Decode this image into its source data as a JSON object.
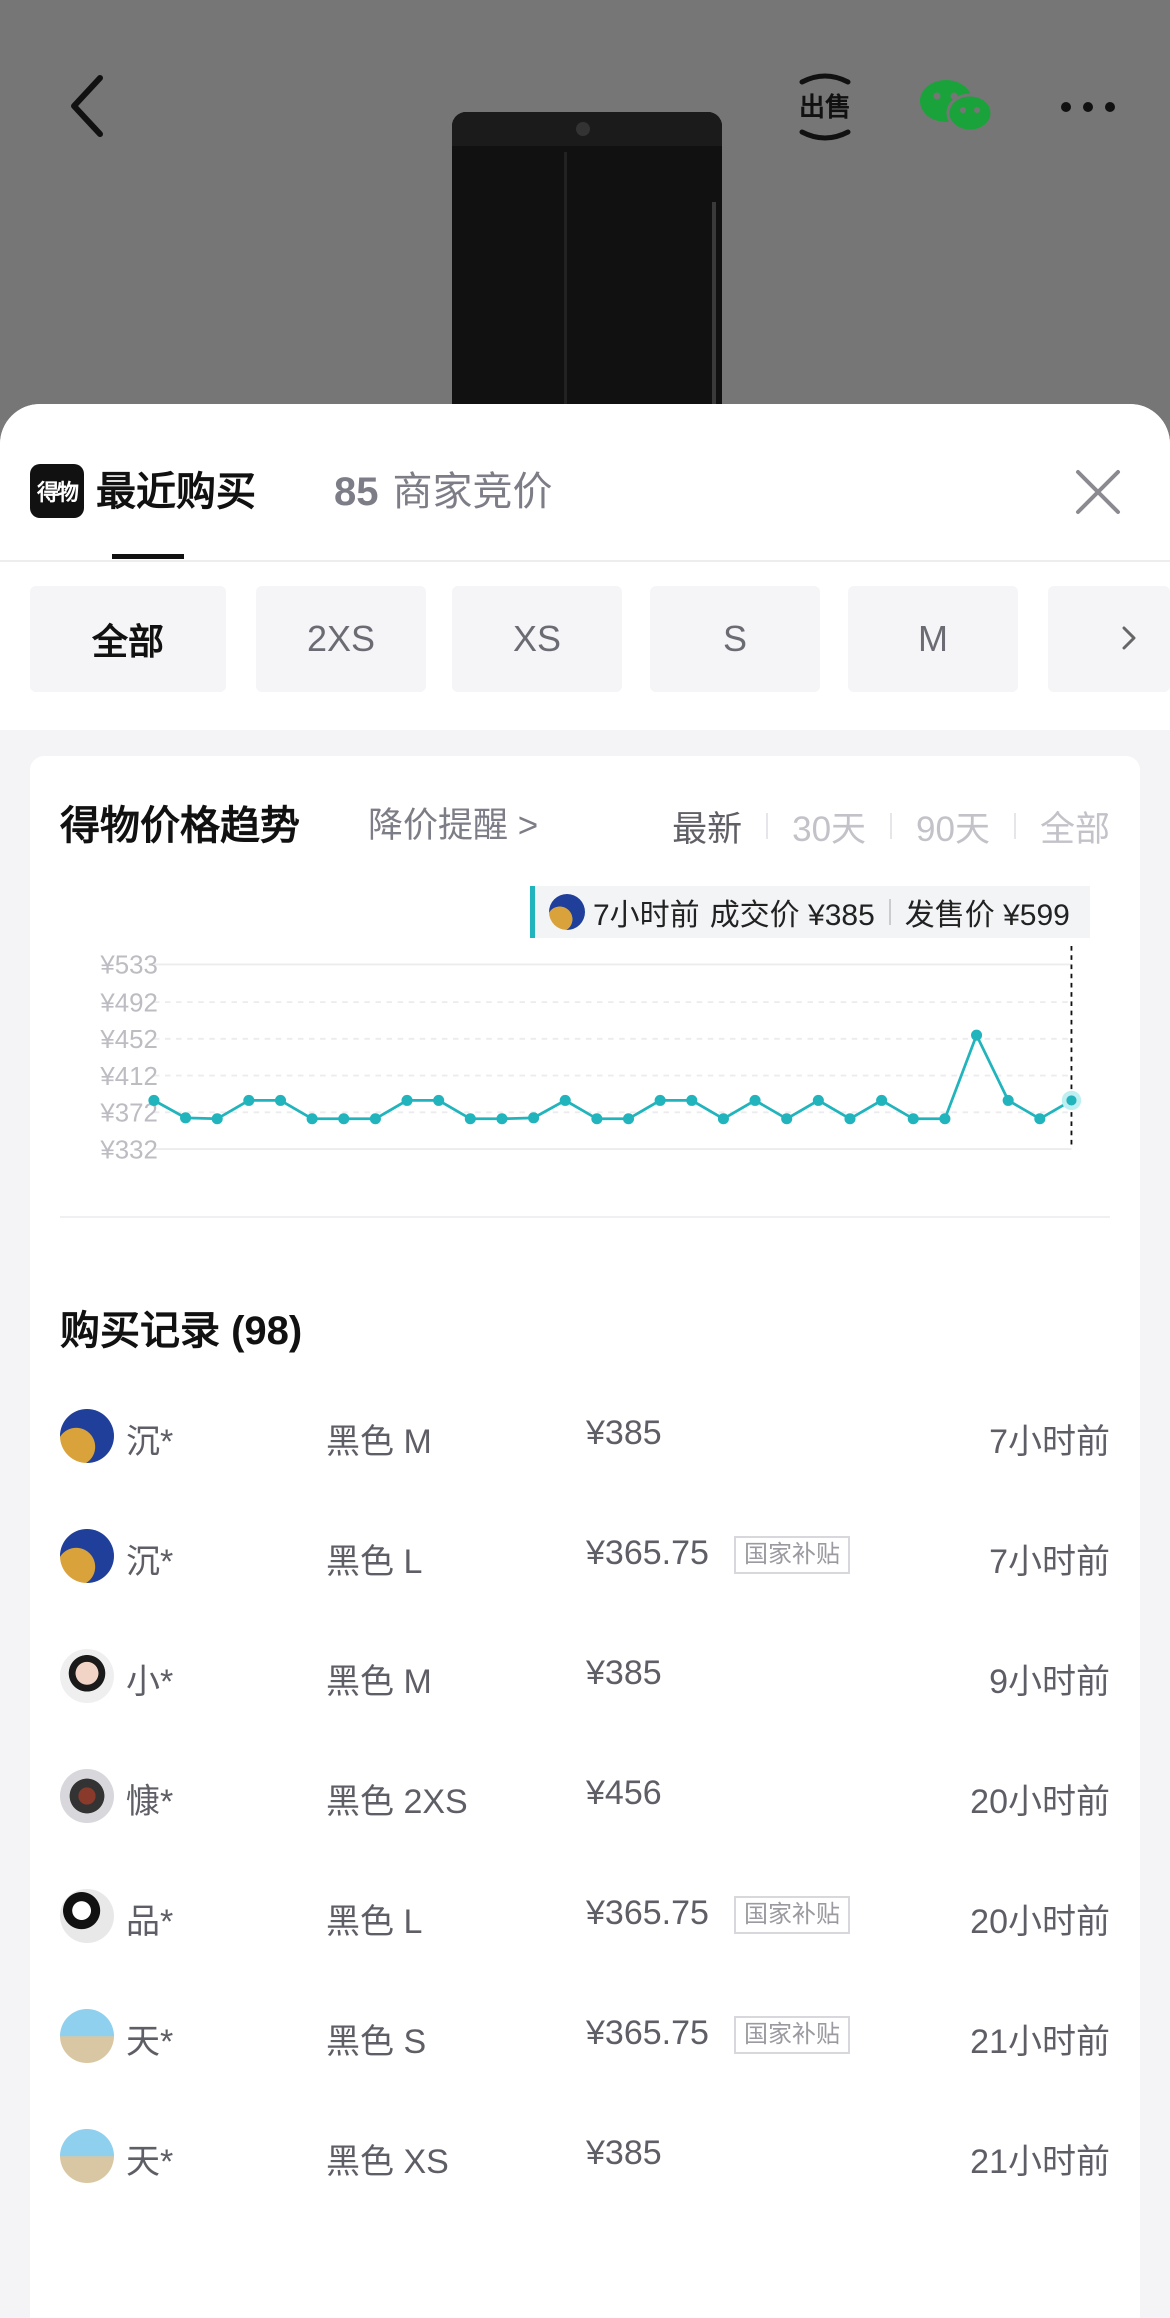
{
  "header": {
    "sell_label": "出售"
  },
  "sheet": {
    "logo_text": "得物",
    "tab_recent": "最近购买",
    "tab_bids_count": "85",
    "tab_bids_label": "商家竞价"
  },
  "sizes": [
    "全部",
    "2XS",
    "XS",
    "S",
    "M"
  ],
  "trend": {
    "title": "得物价格趋势",
    "drop_alert": "降价提醒 >",
    "ranges": [
      "最新",
      "30天",
      "90天",
      "全部"
    ],
    "tooltip_time": "7小时前",
    "tooltip_deal": "成交价 ¥385",
    "tooltip_release": "发售价 ¥599"
  },
  "chart_data": {
    "type": "line",
    "y_ticks": [
      "¥533",
      "¥492",
      "¥452",
      "¥412",
      "¥372",
      "¥332"
    ],
    "ylim": [
      332,
      533
    ],
    "grid": true,
    "series": [
      {
        "values": [
          385,
          366,
          365,
          385,
          385,
          365,
          365,
          365,
          385,
          385,
          365,
          365,
          366,
          385,
          365,
          365,
          385,
          385,
          365,
          385,
          365,
          385,
          365,
          385,
          365,
          365,
          456,
          385,
          365,
          385
        ]
      }
    ],
    "highlight_index": 29,
    "line_color": "#21b4bc"
  },
  "records": {
    "title": "购买记录 (98)",
    "items": [
      {
        "name": "沉*",
        "size": "黑色 M",
        "price": "¥385",
        "tag": "",
        "time": "7小时前",
        "avatar": "flag"
      },
      {
        "name": "沉*",
        "size": "黑色 L",
        "price": "¥365.75",
        "tag": "国家补贴",
        "time": "7小时前",
        "avatar": "flag"
      },
      {
        "name": "小*",
        "size": "黑色 M",
        "price": "¥385",
        "tag": "",
        "time": "9小时前",
        "avatar": "girl"
      },
      {
        "name": "慷*",
        "size": "黑色 2XS",
        "price": "¥456",
        "tag": "",
        "time": "20小时前",
        "avatar": "art"
      },
      {
        "name": "品*",
        "size": "黑色 L",
        "price": "¥365.75",
        "tag": "国家补贴",
        "time": "20小时前",
        "avatar": "cow"
      },
      {
        "name": "天*",
        "size": "黑色 S",
        "price": "¥365.75",
        "tag": "国家补贴",
        "time": "21小时前",
        "avatar": "sky"
      },
      {
        "name": "天*",
        "size": "黑色 XS",
        "price": "¥385",
        "tag": "",
        "time": "21小时前",
        "avatar": "sky"
      }
    ]
  }
}
